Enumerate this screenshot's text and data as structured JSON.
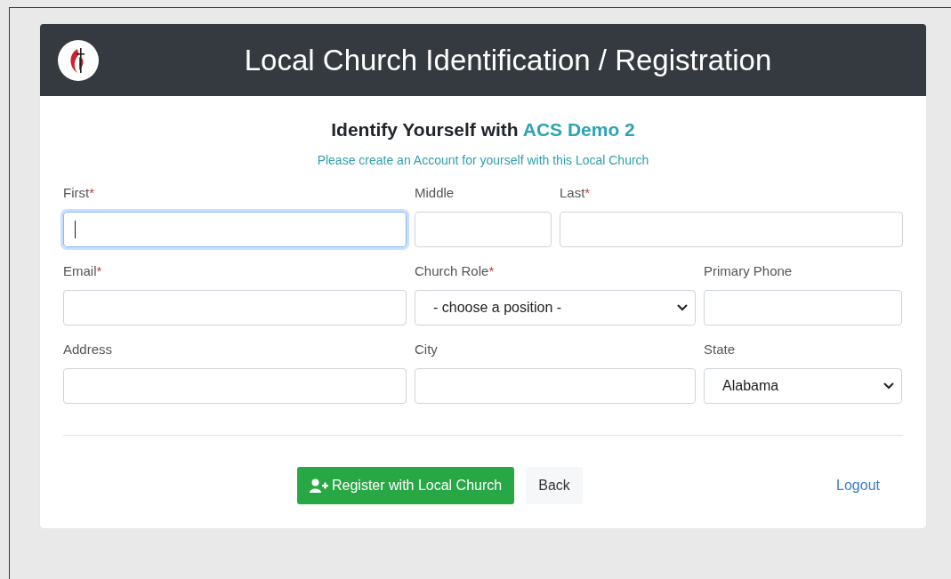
{
  "header": {
    "title": "Local Church Identification / Registration"
  },
  "heading": {
    "text": "Identify Yourself with",
    "church": "ACS Demo 2"
  },
  "subtitle": "Please create an Account for yourself with this Local Church",
  "rows": [
    [
      {
        "label": "First",
        "mark": "*",
        "kind": "text",
        "focused": true
      },
      {
        "label": "Middle",
        "kind": "text",
        "focused": false
      },
      {
        "label": "Last",
        "mark": "*",
        "kind": "text",
        "focused": false
      }
    ],
    [
      {
        "label": "Email",
        "mark": "*",
        "kind": "text",
        "focused": false
      },
      {
        "label": "Church Role",
        "mark": "*",
        "kind": "select",
        "value": "- choose a position -"
      },
      {
        "label": "Primary Phone",
        "kind": "text",
        "focused": false
      }
    ],
    [
      {
        "label": "Address",
        "kind": "text",
        "focused": false
      },
      {
        "label": "City",
        "kind": "text",
        "focused": false
      },
      {
        "label": "State",
        "kind": "select",
        "value": "Alabama"
      }
    ]
  ],
  "actions": [
    {
      "label": "Register with Local Church",
      "kind": "primary"
    },
    {
      "label": "Back",
      "kind": "light"
    },
    {
      "label": "Logout",
      "kind": "link"
    }
  ]
}
